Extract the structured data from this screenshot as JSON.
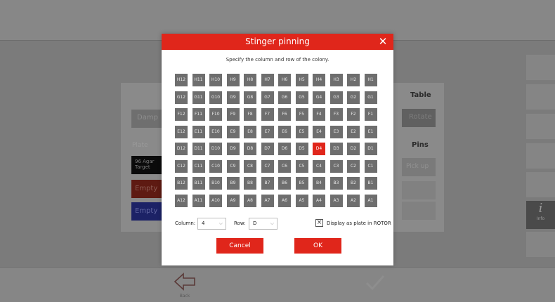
{
  "background": {
    "damp_label": "Damp",
    "plate_label": "Plate",
    "agar_tag": "96 Agar Target",
    "empty_red": "Empty",
    "empty_blue": "Empty",
    "table_title": "Table",
    "rotate_label": "Rotate",
    "pins_title": "Pins",
    "pickup_label": "Pick up",
    "info_label": "Info",
    "back_label": "Back"
  },
  "dialog": {
    "title": "Stinger pinning",
    "close_icon": "close-icon",
    "instruction": "Specify the column and row of the colony.",
    "rows": [
      "H",
      "G",
      "F",
      "E",
      "D",
      "C",
      "B",
      "A"
    ],
    "columns": [
      12,
      11,
      10,
      9,
      8,
      7,
      6,
      5,
      4,
      3,
      2,
      1
    ],
    "selected_well": "D4",
    "column_label": "Column:",
    "column_value": "4",
    "row_label": "Row:",
    "row_value": "D",
    "checkbox_checked": true,
    "checkbox_label": "Display as plate in ROTOR",
    "cancel_label": "Cancel",
    "ok_label": "OK"
  },
  "colors": {
    "accent": "#e0261b",
    "well": "#6e6e6e"
  }
}
